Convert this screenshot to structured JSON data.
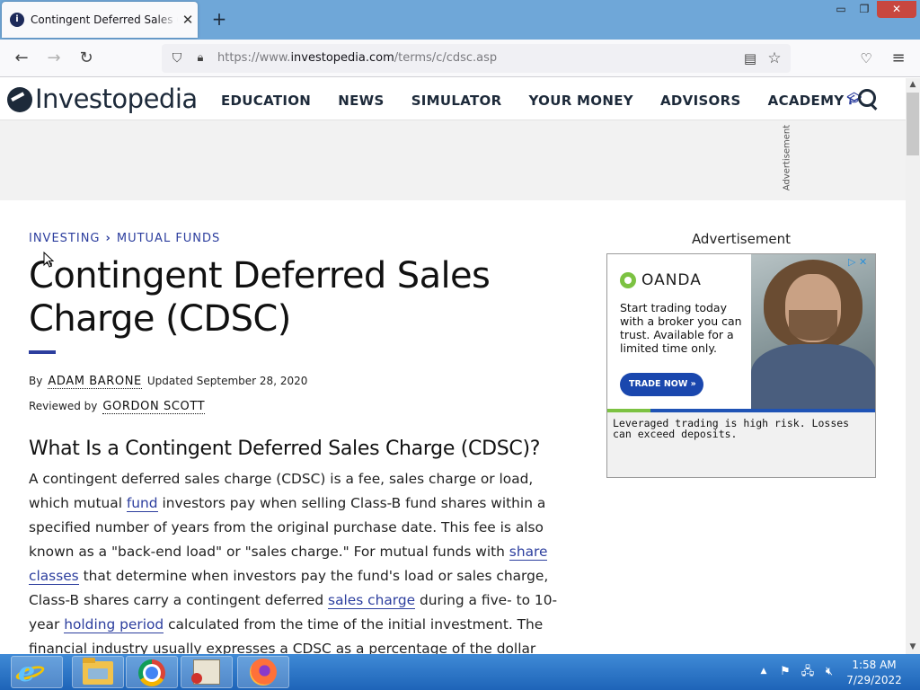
{
  "browser": {
    "tab_title": "Contingent Deferred Sales Charge",
    "tab_close": "✕",
    "new_tab": "+",
    "window_min": "▭",
    "window_max": "❐",
    "window_close": "✕",
    "url_prefix": "https://www.",
    "url_host": "investopedia.com",
    "url_path": "/terms/c/cdsc.asp"
  },
  "site": {
    "logo": "Investopedia",
    "nav": [
      "EDUCATION",
      "NEWS",
      "SIMULATOR",
      "YOUR MONEY",
      "ADVISORS",
      "ACADEMY"
    ],
    "top_ad_label": "Advertisement"
  },
  "article": {
    "breadcrumb": [
      "INVESTING",
      "MUTUAL FUNDS"
    ],
    "title": "Contingent Deferred Sales Charge (CDSC)",
    "by_label": "By",
    "author": "ADAM BARONE",
    "updated": "Updated September 28, 2020",
    "reviewed_label": "Reviewed by",
    "reviewer": "GORDON SCOTT",
    "heading": "What Is a Contingent Deferred Sales Charge (CDSC)?",
    "p1": "A contingent deferred sales charge (CDSC) is a fee, sales charge or load, which mutual ",
    "link_fund": "fund",
    "p2": " investors pay when selling Class-B fund shares within a specified number of years from the original purchase date. This fee is also known as a \"back-end load\" or \"sales charge.\" For mutual funds with ",
    "link_share_classes": "share classes",
    "p3": " that determine when investors pay the fund's load or sales charge, Class-B shares carry a contingent deferred ",
    "link_sales_charge": "sales charge",
    "p4": " during a five- to 10-year ",
    "link_holding_period": "holding period",
    "p5": " calculated from the time of the initial investment. The financial industry usually expresses a CDSC as a percentage of the dollar amount invested into a"
  },
  "side_ad": {
    "label": "Advertisement",
    "brand": "OANDA",
    "copy": "Start trading today with a broker you can trust. Available for a limited time only.",
    "cta": "TRADE NOW",
    "cta_arrow": "»",
    "choices": "▷ ✕",
    "disclaimer": "Leveraged trading is high risk. Losses can exceed deposits."
  },
  "taskbar": {
    "time": "1:58 AM",
    "date": "7/29/2022"
  },
  "colors": {
    "accent": "#2c3e9e",
    "brand_dark": "#1d2a3a",
    "tabbar": "#6fa7d8",
    "taskbar": "#1e64b8",
    "oanda_green": "#7cc242",
    "oanda_blue": "#1a47ae"
  },
  "icons": {
    "back": "back-arrow-icon",
    "forward": "forward-arrow-icon",
    "reload": "reload-icon",
    "shield": "tracking-protection-shield-icon",
    "lock": "lock-icon",
    "reader": "reader-view-icon",
    "bookmark": "bookmark-star-icon",
    "pocket": "pocket-icon",
    "menu": "hamburger-menu-icon",
    "search": "search-icon",
    "academy": "graduation-cap-icon"
  }
}
